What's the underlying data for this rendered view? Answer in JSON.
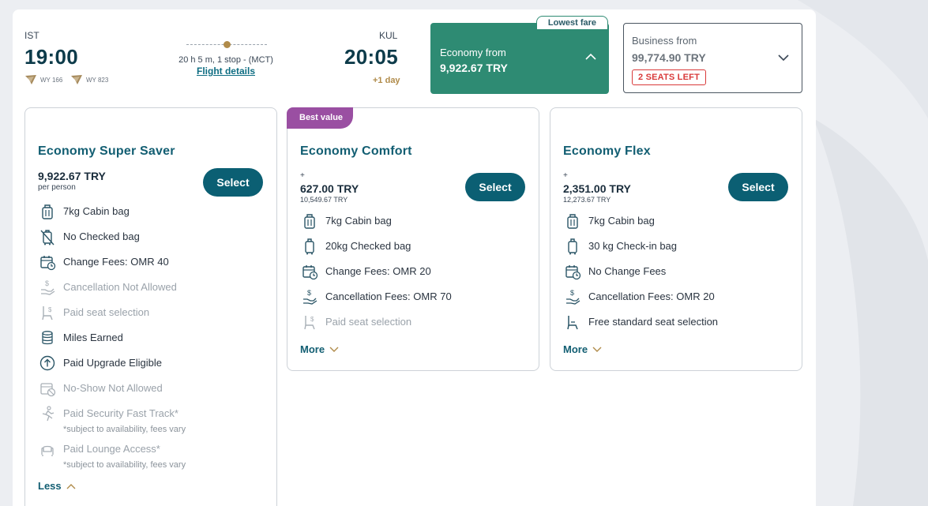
{
  "flight": {
    "departure": {
      "code": "IST",
      "time": "19:00"
    },
    "arrival": {
      "code": "KUL",
      "time": "20:05",
      "day_offset": "+1 day"
    },
    "duration": "20 h 5 m, 1 stop - (MCT)",
    "details_link": "Flight details",
    "flight_numbers": [
      "WY 166",
      "WY 823"
    ]
  },
  "cabins": {
    "economy": {
      "label": "Economy from",
      "price": "9,922.67 TRY",
      "badge": "Lowest fare",
      "icon": "chevron-up-icon"
    },
    "business": {
      "label": "Business from",
      "price": "99,774.90 TRY",
      "seats_left": "2 SEATS LEFT",
      "icon": "chevron-down-icon"
    }
  },
  "colors": {
    "accent": "#0b5f73",
    "economy_tab": "#2e8b73",
    "best_value": "#9a4fa2",
    "gold": "#b08b4a",
    "alert": "#d93a3a"
  },
  "fares": [
    {
      "name": "Economy Super Saver",
      "plus": "",
      "price": "9,922.67 TRY",
      "sub": "per person",
      "select_label": "Select",
      "features": [
        {
          "icon": "cabin-bag-icon",
          "text": "7kg Cabin bag",
          "dim": false
        },
        {
          "icon": "no-checked-bag-icon",
          "text": "No Checked bag",
          "dim": false
        },
        {
          "icon": "calendar-clock-icon",
          "text": "Change Fees: OMR 40",
          "dim": false
        },
        {
          "icon": "hand-money-icon",
          "text": "Cancellation Not Allowed",
          "dim": true
        },
        {
          "icon": "seat-money-icon",
          "text": "Paid seat selection",
          "dim": true
        },
        {
          "icon": "coins-icon",
          "text": "Miles Earned",
          "dim": false
        },
        {
          "icon": "upgrade-arrow-icon",
          "text": "Paid Upgrade Eligible",
          "dim": false
        },
        {
          "icon": "no-show-icon",
          "text": "No-Show Not Allowed",
          "dim": true
        },
        {
          "icon": "fast-track-icon",
          "text": "Paid Security Fast Track*",
          "note": "*subject to availability, fees vary",
          "dim": true
        },
        {
          "icon": "lounge-icon",
          "text": "Paid Lounge Access*",
          "note": "*subject to availability, fees vary",
          "dim": true
        }
      ],
      "toggle": "Less"
    },
    {
      "name": "Economy Comfort",
      "badge": "Best value",
      "plus": "+",
      "price": "627.00 TRY",
      "sub": "10,549.67 TRY",
      "select_label": "Select",
      "features": [
        {
          "icon": "cabin-bag-icon",
          "text": "7kg Cabin bag",
          "dim": false
        },
        {
          "icon": "checked-bag-icon",
          "text": "20kg Checked bag",
          "dim": false
        },
        {
          "icon": "calendar-clock-icon",
          "text": "Change Fees: OMR 20",
          "dim": false
        },
        {
          "icon": "hand-money-icon",
          "text": "Cancellation Fees: OMR 70",
          "dim": false
        },
        {
          "icon": "seat-money-icon",
          "text": "Paid seat selection",
          "dim": true
        }
      ],
      "toggle": "More"
    },
    {
      "name": "Economy Flex",
      "plus": "+",
      "price": "2,351.00 TRY",
      "sub": "12,273.67 TRY",
      "select_label": "Select",
      "features": [
        {
          "icon": "cabin-bag-icon",
          "text": "7kg Cabin bag",
          "dim": false
        },
        {
          "icon": "checked-bag-icon",
          "text": "30 kg Check-in bag",
          "dim": false
        },
        {
          "icon": "calendar-clock-icon",
          "text": "No Change Fees",
          "dim": false
        },
        {
          "icon": "hand-money-icon",
          "text": "Cancellation Fees: OMR 20",
          "dim": false
        },
        {
          "icon": "seat-icon",
          "text": "Free standard seat selection",
          "dim": false
        }
      ],
      "toggle": "More"
    }
  ]
}
